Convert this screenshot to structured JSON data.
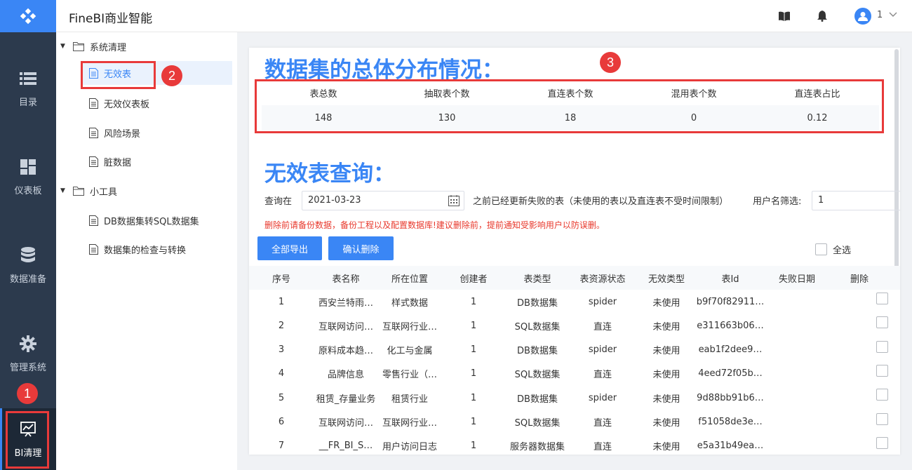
{
  "app": {
    "title": "FineBI商业智能"
  },
  "header": {
    "user_num": "1"
  },
  "nav": {
    "items": [
      {
        "label": "目录"
      },
      {
        "label": "仪表板"
      },
      {
        "label": "数据准备"
      },
      {
        "label": "管理系统"
      },
      {
        "label": "BI清理"
      }
    ]
  },
  "tree": {
    "group1": "系统清理",
    "group1_items": [
      "无效表",
      "无效仪表板",
      "风险场景",
      "脏数据"
    ],
    "group2": "小工具",
    "group2_items": [
      "DB数据集转SQL数据集",
      "数据集的检查与转换"
    ]
  },
  "content": {
    "title1": "数据集的总体分布情况：",
    "stats": {
      "headers": [
        "表总数",
        "抽取表个数",
        "直连表个数",
        "混用表个数",
        "直连表占比"
      ],
      "values": [
        "148",
        "130",
        "18",
        "0",
        "0.12"
      ]
    },
    "title2": "无效表查询：",
    "query": {
      "prefix": "查询在",
      "date": "2021-03-23",
      "suffix": "之前已经更新失败的表（未使用的表以及直连表不受时间限制）",
      "user_label": "用户名筛选:",
      "user_value": "1"
    },
    "warning": "删除前请备份数据，备份工程以及配置数据库!建议删除前，提前通知受影响用户以防误删。",
    "buttons": {
      "export_all": "全部导出",
      "confirm_delete": "确认删除"
    },
    "select_all": "全选",
    "table": {
      "headers": [
        "序号",
        "表名称",
        "所在位置",
        "创建者",
        "表类型",
        "表资源状态",
        "无效类型",
        "表Id",
        "失败日期",
        "删除"
      ],
      "rows": [
        [
          "1",
          "西安兰特雨…",
          "样式数据",
          "1",
          "DB数据集",
          "spider",
          "未使用",
          "b9f70f82911…",
          ""
        ],
        [
          "2",
          "互联网访问…",
          "互联网行业…",
          "1",
          "SQL数据集",
          "直连",
          "未使用",
          "e311663b06…",
          ""
        ],
        [
          "3",
          "原料成本趋…",
          "化工与金属",
          "1",
          "DB数据集",
          "spider",
          "未使用",
          "eab1f2dee9…",
          ""
        ],
        [
          "4",
          "品牌信息",
          "零售行业（…",
          "1",
          "SQL数据集",
          "直连",
          "未使用",
          "4eed72f05b…",
          ""
        ],
        [
          "5",
          "租赁_存量业务",
          "租赁行业",
          "1",
          "DB数据集",
          "spider",
          "未使用",
          "9d88bb91b6…",
          ""
        ],
        [
          "6",
          "互联网访问…",
          "互联网行业…",
          "1",
          "SQL数据集",
          "直连",
          "未使用",
          "f51058de3e…",
          ""
        ],
        [
          "7",
          "__FR_BI_S…",
          "用户访问日志",
          "1",
          "服务器数据集",
          "直连",
          "未使用",
          "e5a31b49ea…",
          ""
        ]
      ]
    }
  },
  "annotations": [
    "1",
    "2",
    "3"
  ],
  "colors": {
    "accent": "#3a86f5",
    "nav_bg": "#2c3a4d",
    "callout": "#e83a3a",
    "warning": "#e8382c"
  }
}
